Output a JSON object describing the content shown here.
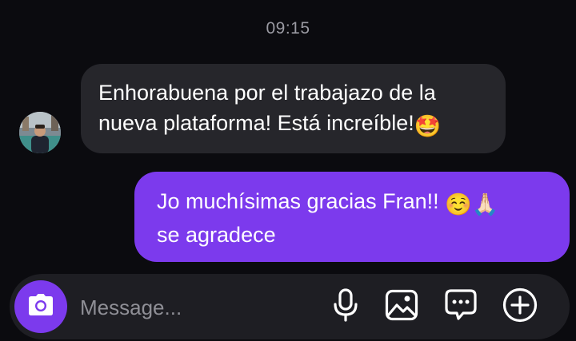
{
  "conversation": {
    "timestamp": "09:15"
  },
  "messages": [
    {
      "sender": "other",
      "lines": [
        "Enhorabuena por el trabajazo de la",
        "nueva plataforma! Está increíble!"
      ],
      "emoji": "🤩"
    },
    {
      "sender": "me",
      "lines": [
        "Jo muchísimas gracias Fran!!",
        "se agradece"
      ],
      "emoji": "☺️🙏🏻"
    }
  ],
  "composer": {
    "placeholder": "Message...",
    "value": ""
  },
  "icons": {
    "camera": "camera-icon",
    "microphone": "microphone-icon",
    "gallery": "gallery-icon",
    "sticker": "chat-bubble-icon",
    "add": "plus-circle-icon"
  },
  "colors": {
    "background": "#0b0b0f",
    "incoming_bubble": "#26262b",
    "outgoing_bubble": "#7c3aed",
    "accent": "#7c3aed",
    "timestamp_text": "#9a9aa2"
  }
}
